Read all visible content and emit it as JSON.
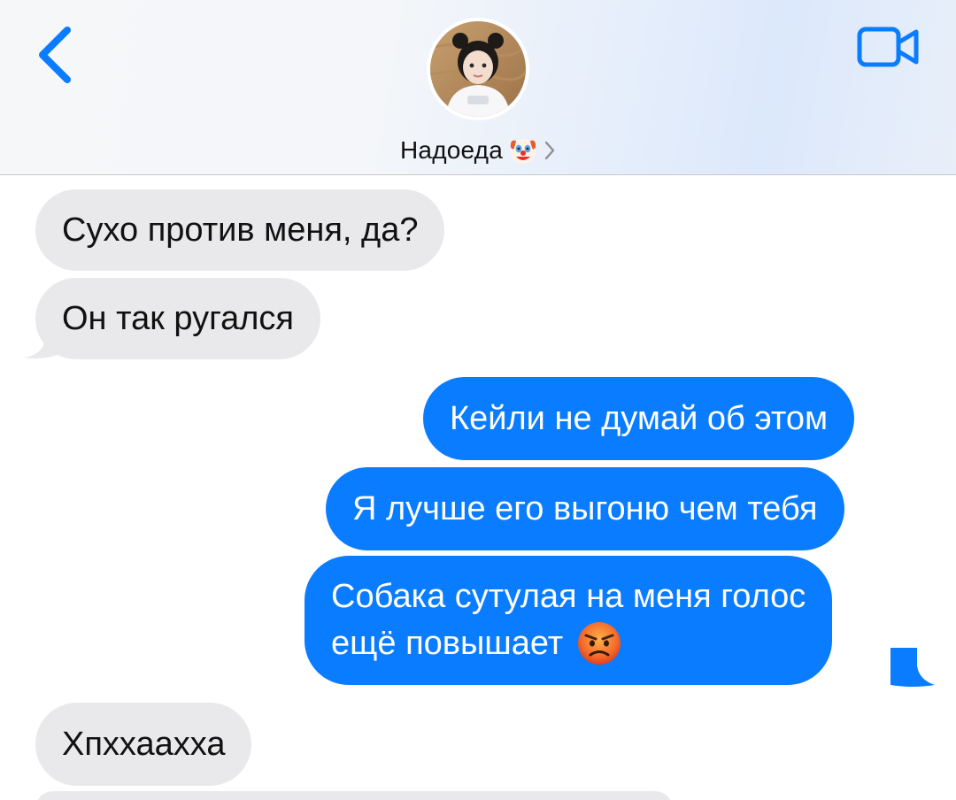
{
  "header": {
    "contact_name": "Надоеда",
    "contact_emoji": "clown-face",
    "back_icon": "chevron-left",
    "video_icon": "video-camera"
  },
  "colors": {
    "accent": "#0a7cff",
    "incoming_bubble": "#e9e9eb",
    "outgoing_bubble": "#0a7cff",
    "incoming_text": "#111111",
    "outgoing_text": "#ffffff"
  },
  "messages": [
    {
      "from": "contact",
      "text": "Сухо против меня, да?"
    },
    {
      "from": "contact",
      "text": "Он так ругался"
    },
    {
      "from": "me",
      "text": "Кейли не думай об этом"
    },
    {
      "from": "me",
      "text": "Я лучше его выгоню чем тебя"
    },
    {
      "from": "me",
      "line1": "Собака сутулая на меня голос",
      "line2": "ещё повышает",
      "emoji": "angry-face"
    },
    {
      "from": "contact",
      "text": "Хпххаахха"
    }
  ]
}
